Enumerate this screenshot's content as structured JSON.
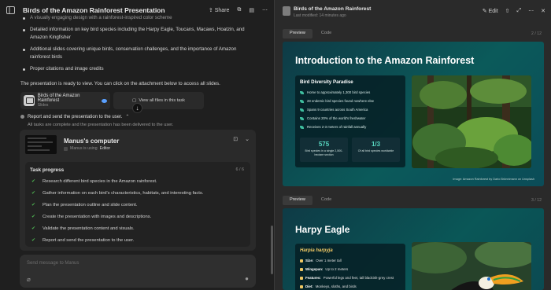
{
  "left_header": {
    "title": "Birds of the Amazon Rainforest Presentation",
    "share_label": "Share"
  },
  "chat": {
    "bullets": [
      "A visually engaging design with a rainforest-inspired color scheme",
      "Detailed information on key bird species including the Harpy Eagle, Toucans, Macaws, Hoatzin, and Amazon Kingfisher",
      "Additional slides covering unique birds, conservation challenges, and the importance of Amazon rainforest birds",
      "Proper citations and image credits"
    ],
    "ready_text": "The presentation is ready to view. You can click on the attachment below to access all slides.",
    "attachment": {
      "name": "Birds of the Amazon Rainforest",
      "type": "Slides"
    },
    "view_all_label": "View all files in this task",
    "step_title": "Report and send the presentation to the user.",
    "done_message": "All tasks are complete and the presentation has been delivered to the user."
  },
  "computer": {
    "title": "Manus's computer",
    "status": "Manus is using",
    "tool": "Editor",
    "progress_title": "Task progress",
    "progress_count": "6 / 6",
    "tasks": [
      "Research different bird species in the Amazon rainforest.",
      "Gather information on each bird's characteristics, habitats, and interesting facts.",
      "Plan the presentation outline and slide content.",
      "Create the presentation with images and descriptions.",
      "Validate the presentation content and visuals.",
      "Report and send the presentation to the user."
    ]
  },
  "input": {
    "placeholder": "Send message to Manus"
  },
  "right_header": {
    "title": "Birds of the Amazon Rainforest",
    "subtitle": "Last modified: 14 minutes ago",
    "edit_label": "Edit"
  },
  "tabs": {
    "preview": "Preview",
    "code": "Code"
  },
  "slide1": {
    "page": "2 / 12",
    "title": "Introduction to the Amazon Rainforest",
    "box_title": "Bird Diversity Paradise",
    "facts": [
      "Home to approximately 1,300 bird species",
      "28 endemic bird species found nowhere else",
      "Spans 9 countries across South America",
      "Contains 20% of the world's freshwater",
      "Receives 2-3 meters of rainfall annually"
    ],
    "stats": [
      {
        "value": "575",
        "caption": "Bird species in a single 2,500-hectare section"
      },
      {
        "value": "1/3",
        "caption": "Of all bird species worldwide"
      }
    ],
    "credit": "Image: Amazon Rainforest by Dario Brönnimann on Unsplash"
  },
  "slide2": {
    "page": "3 / 12",
    "title": "Harpy Eagle",
    "box_title": "Harpia harpyja",
    "facts": [
      {
        "label": "Size:",
        "text": "Over 1 meter tall"
      },
      {
        "label": "Wingspan:",
        "text": "Up to 2 meters"
      },
      {
        "label": "Features:",
        "text": "Powerful legs and feet, tall blackish-grey crest"
      },
      {
        "label": "Diet:",
        "text": "Monkeys, sloths, and birds"
      }
    ]
  },
  "colors": {
    "slide_bg": "#0b5a5a",
    "accent": "#58d6c0",
    "check": "#4caf50",
    "highlight": "#f0c864"
  }
}
